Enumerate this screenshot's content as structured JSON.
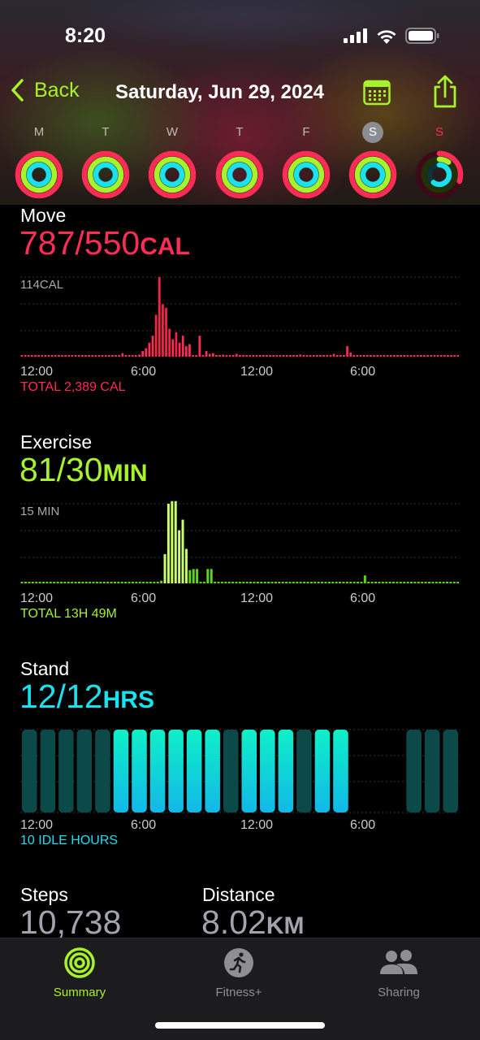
{
  "status_bar": {
    "time": "8:20"
  },
  "nav": {
    "back_label": "Back",
    "title": "Saturday, Jun 29, 2024"
  },
  "week": {
    "days": [
      {
        "letter": "M",
        "move": 1.0,
        "exercise": 1.0,
        "stand": 1.0
      },
      {
        "letter": "T",
        "move": 1.0,
        "exercise": 1.0,
        "stand": 1.0
      },
      {
        "letter": "W",
        "move": 1.0,
        "exercise": 1.0,
        "stand": 1.0
      },
      {
        "letter": "T",
        "move": 1.0,
        "exercise": 1.0,
        "stand": 1.0
      },
      {
        "letter": "F",
        "move": 1.0,
        "exercise": 1.0,
        "stand": 1.0
      },
      {
        "letter": "S",
        "move": 1.0,
        "exercise": 1.0,
        "stand": 1.0,
        "selected": true
      },
      {
        "letter": "S",
        "move": 0.3,
        "exercise": 0.1,
        "stand": 0.6,
        "today": true
      }
    ]
  },
  "move": {
    "title": "Move",
    "value": "787/550",
    "unit": "CAL",
    "axis_max_label": "114CAL",
    "total": "TOTAL 2,389 CAL",
    "x_labels": [
      "12:00",
      "6:00",
      "12:00",
      "6:00"
    ]
  },
  "exercise": {
    "title": "Exercise",
    "value": "81/30",
    "unit": "MIN",
    "axis_max_label": "15 MIN",
    "total": "TOTAL 13H 49M",
    "x_labels": [
      "12:00",
      "6:00",
      "12:00",
      "6:00"
    ]
  },
  "stand": {
    "title": "Stand",
    "value": "12/12",
    "unit": "HRS",
    "total": "10 IDLE HOURS",
    "x_labels": [
      "12:00",
      "6:00",
      "12:00",
      "6:00"
    ]
  },
  "steps": {
    "title": "Steps",
    "value": "10,738"
  },
  "distance": {
    "title": "Distance",
    "value": "8.02",
    "unit": "KM"
  },
  "tabs": [
    {
      "label": "Summary",
      "icon": "activity-rings-icon",
      "active": true
    },
    {
      "label": "Fitness+",
      "icon": "runner-icon"
    },
    {
      "label": "Sharing",
      "icon": "people-icon"
    }
  ],
  "colors": {
    "move": "#ff2d55",
    "exercise": "#a6f22b",
    "stand": "#1be0ee",
    "accent": "#a6f22b",
    "background": "#000000"
  },
  "chart_data": [
    {
      "type": "bar",
      "name": "move",
      "ylabel": "CAL",
      "ylim": [
        0,
        114
      ],
      "series": [
        {
          "name": "",
          "values": [
            2,
            2,
            2,
            2,
            2,
            2,
            2,
            2,
            2,
            2,
            2,
            2,
            2,
            2,
            2,
            2,
            2,
            2,
            2,
            2,
            2,
            2,
            2,
            2,
            2,
            2,
            2,
            2,
            2,
            2,
            5,
            2,
            2,
            2,
            2,
            3,
            8,
            12,
            20,
            30,
            60,
            114,
            75,
            70,
            40,
            25,
            35,
            20,
            30,
            15,
            18,
            2,
            2,
            30,
            2,
            8,
            4,
            5,
            2,
            2,
            3,
            2,
            2,
            2,
            4,
            2,
            2,
            2,
            2,
            2,
            2,
            2,
            2,
            2,
            2,
            2,
            2,
            2,
            2,
            2,
            2,
            2,
            2,
            3,
            2,
            2,
            2,
            2,
            2,
            2,
            2,
            2,
            2,
            4,
            2,
            2,
            2,
            15,
            6,
            2,
            2,
            2,
            2,
            2,
            2,
            2,
            2,
            2,
            2,
            2,
            2,
            2,
            2,
            2,
            2,
            2,
            2,
            2,
            2,
            2,
            2,
            2,
            2,
            2,
            2,
            2,
            2,
            2,
            2,
            2,
            2
          ]
        }
      ]
    },
    {
      "type": "bar",
      "name": "exercise",
      "ylabel": "MIN",
      "ylim": [
        0,
        15
      ],
      "series": [
        {
          "name": "",
          "values": [
            0.2,
            0.2,
            0.2,
            0.2,
            0.2,
            0.2,
            0.2,
            0.2,
            0.2,
            0.2,
            0.2,
            0.2,
            0.2,
            0.2,
            0.2,
            0.2,
            0.2,
            0.2,
            0.2,
            0.2,
            0.2,
            0.2,
            0.2,
            0.2,
            0.2,
            0.2,
            0.2,
            0.2,
            0.2,
            0.2,
            0.2,
            0.2,
            0.2,
            0.2,
            0.2,
            0.2,
            0.2,
            0.2,
            0.2,
            0.5,
            5.5,
            15,
            15.5,
            15.5,
            10,
            12,
            6.5,
            2.5,
            2.7,
            2.7,
            0.2,
            0.2,
            2.7,
            2.7,
            0.2,
            0.2,
            0.2,
            0.2,
            0.2,
            0.2,
            0.2,
            0.2,
            0.2,
            0.2,
            0.2,
            0.2,
            0.2,
            0.2,
            0.2,
            0.2,
            0.2,
            0.2,
            0.2,
            0.2,
            0.2,
            0.2,
            0.2,
            0.2,
            0.2,
            0.2,
            0.2,
            0.2,
            0.2,
            0.2,
            0.2,
            0.2,
            0.2,
            0.2,
            0.2,
            0.2,
            0.2,
            0.2,
            0.2,
            0.2,
            0.2,
            0.2,
            1.5,
            0.2,
            0.2,
            0.2,
            0.2,
            0.2,
            0.2,
            0.2,
            0.2,
            0.2,
            0.2,
            0.2,
            0.2,
            0.2,
            0.2,
            0.2,
            0.2,
            0.2,
            0.2,
            0.2,
            0.2,
            0.2,
            0.2,
            0.2,
            0.2,
            0.2,
            0.2
          ]
        }
      ]
    },
    {
      "type": "bar",
      "name": "stand",
      "ylabel": "HRS",
      "categories": [
        "0",
        "1",
        "2",
        "3",
        "4",
        "5",
        "6",
        "7",
        "8",
        "9",
        "10",
        "11",
        "12",
        "13",
        "14",
        "15",
        "16",
        "17",
        "18",
        "19",
        "20",
        "21",
        "22",
        "23"
      ],
      "series": [
        {
          "name": "",
          "values": [
            0,
            0,
            0,
            0,
            0,
            1,
            1,
            1,
            1,
            1,
            1,
            0,
            1,
            1,
            1,
            0,
            1,
            1,
            null,
            null,
            null,
            0,
            0,
            0
          ]
        }
      ]
    }
  ]
}
